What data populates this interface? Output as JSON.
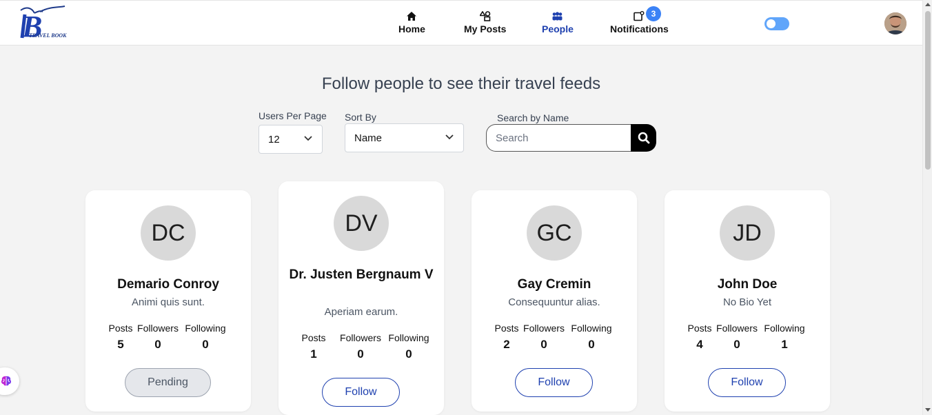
{
  "app": {
    "logo_text": "TRAVEL BOOK"
  },
  "nav": {
    "items": [
      {
        "label": "Home",
        "icon": "home-icon"
      },
      {
        "label": "My Posts",
        "icon": "shapes-icon"
      },
      {
        "label": "People",
        "icon": "people-icon",
        "active": true
      },
      {
        "label": "Notifications",
        "icon": "notification-icon",
        "badge": "3"
      }
    ]
  },
  "theme_toggle": {
    "on": true,
    "color": "#60a5fa"
  },
  "page": {
    "title": "Follow people to see their travel feeds"
  },
  "controls": {
    "per_page": {
      "label": "Users Per Page",
      "value": "12"
    },
    "sort": {
      "label": "Sort By",
      "value": "Name"
    },
    "search": {
      "label": "Search by Name",
      "placeholder": "Search"
    }
  },
  "stat_labels": {
    "posts": "Posts",
    "followers": "Followers",
    "following": "Following"
  },
  "users": [
    {
      "initials": "DC",
      "name": "Demario Conroy",
      "bio": "Animi quis sunt.",
      "posts": "5",
      "followers": "0",
      "following": "0",
      "action": "Pending"
    },
    {
      "initials": "DV",
      "name": "Dr. Justen Bergnaum V",
      "bio": "Aperiam earum.",
      "posts": "1",
      "followers": "0",
      "following": "0",
      "action": "Follow"
    },
    {
      "initials": "GC",
      "name": "Gay Cremin",
      "bio": "Consequuntur alias.",
      "posts": "2",
      "followers": "0",
      "following": "0",
      "action": "Follow"
    },
    {
      "initials": "JD",
      "name": "John Doe",
      "bio": "No Bio Yet",
      "posts": "4",
      "followers": "0",
      "following": "1",
      "action": "Follow"
    }
  ],
  "colors": {
    "accent": "#1e40af",
    "badge": "#3b82f6",
    "background": "#f3f3f3"
  }
}
